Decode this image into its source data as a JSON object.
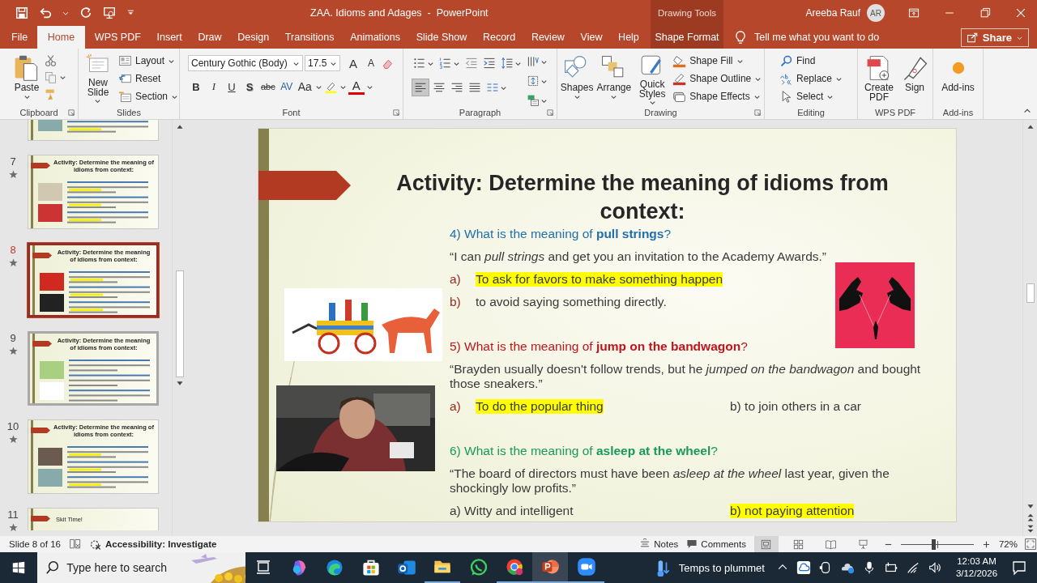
{
  "title_bar": {
    "title": "ZAA. Idioms and Adages  -  PowerPoint",
    "context_label": "Drawing Tools",
    "user_name": "Areeba Rauf",
    "user_initials": "AR"
  },
  "menu_tabs": [
    {
      "label": "File",
      "selected": false,
      "kind": "standard"
    },
    {
      "label": "Home",
      "selected": true,
      "kind": "standard"
    },
    {
      "label": "WPS PDF",
      "selected": false,
      "kind": "standard"
    },
    {
      "label": "Insert",
      "selected": false,
      "kind": "standard"
    },
    {
      "label": "Draw",
      "selected": false,
      "kind": "standard"
    },
    {
      "label": "Design",
      "selected": false,
      "kind": "standard"
    },
    {
      "label": "Transitions",
      "selected": false,
      "kind": "standard"
    },
    {
      "label": "Animations",
      "selected": false,
      "kind": "standard"
    },
    {
      "label": "Slide Show",
      "selected": false,
      "kind": "standard"
    },
    {
      "label": "Record",
      "selected": false,
      "kind": "standard"
    },
    {
      "label": "Review",
      "selected": false,
      "kind": "standard"
    },
    {
      "label": "View",
      "selected": false,
      "kind": "standard"
    },
    {
      "label": "Help",
      "selected": false,
      "kind": "standard"
    },
    {
      "label": "Shape Format",
      "selected": false,
      "kind": "contextual"
    }
  ],
  "tell_me": "Tell me what you want to do",
  "share": "Share",
  "ribbon": {
    "clipboard": {
      "label": "Clipboard",
      "paste": "Paste"
    },
    "slides": {
      "label": "Slides",
      "new_slide": "New Slide",
      "layout": "Layout",
      "reset": "Reset",
      "section": "Section"
    },
    "font": {
      "label": "Font",
      "font_name": "Century Gothic (Body)",
      "font_size": "17.5",
      "size_buttons": [
        "A",
        "A"
      ],
      "format_buttons": [
        "B",
        "I",
        "U",
        "S",
        "abc",
        "AV",
        "Aa"
      ],
      "font_color": "A"
    },
    "paragraph": {
      "label": "Paragraph"
    },
    "drawing": {
      "label": "Drawing",
      "shapes": "Shapes",
      "arrange": "Arrange",
      "quick_styles": "Quick Styles",
      "shape_fill": "Shape Fill",
      "shape_outline": "Shape Outline",
      "shape_effects": "Shape Effects"
    },
    "editing": {
      "label": "Editing",
      "find": "Find",
      "replace": "Replace",
      "select": "Select"
    },
    "wps_pdf": {
      "label": "WPS PDF",
      "create_pdf": "Create PDF",
      "sign": "Sign"
    },
    "add_ins": {
      "label": "Add-ins",
      "add_ins": "Add-ins"
    }
  },
  "thumbnails": [
    {
      "kind": "partial-top",
      "selected": false
    },
    {
      "kind": "full",
      "number": "7",
      "starred": true,
      "selected": false,
      "title": "Activity: Determine the meaning of idioms from context:"
    },
    {
      "kind": "full",
      "number": "8",
      "starred": true,
      "selected": true,
      "title": "Activity: Determine the meaning of idioms from context:"
    },
    {
      "kind": "full",
      "number": "9",
      "starred": true,
      "selected": false,
      "title": "Activity: Determine the meaning of idioms from context:"
    },
    {
      "kind": "full",
      "number": "10",
      "starred": true,
      "selected": false,
      "title": "Activity: Determine the meaning of idioms from context:"
    },
    {
      "kind": "partial-bottom",
      "number": "11",
      "starred": true,
      "selected": false,
      "title": "Skit Time!"
    }
  ],
  "slide": {
    "title": "Activity: Determine the meaning of idioms from context:",
    "questions": [
      {
        "prompt": "4) What is the meaning of **pull strings**?",
        "color": "#1f6fae",
        "quote": "“I can *pull strings* and get you an invitation to the Academy Awards.”",
        "kind": "stacked",
        "options": [
          {
            "label": "a)",
            "text": "To ask for favors to make something happen",
            "highlighted": true
          },
          {
            "label": "b)",
            "text": "to avoid saying something directly.",
            "highlighted": false
          }
        ]
      },
      {
        "prompt": "5) What is the meaning of **jump on the bandwagon**?",
        "color": "#c0151d",
        "quote": "“Brayden usually doesn't follow trends, but he *jumped on the bandwagon* and bought those sneakers.”",
        "kind": "paired",
        "options": [
          {
            "label": "a)",
            "text": "To do the popular thing",
            "highlighted": true
          },
          {
            "text": "b) to join others in a car",
            "highlighted": false
          }
        ]
      },
      {
        "prompt": "6) What is the meaning of **asleep at the wheel**?",
        "color": "#1a9a5a",
        "quote": "“The board of directors must have been *asleep at the wheel* last year, given the shockingly low profits.”",
        "kind": "paired",
        "options": [
          {
            "text": "a) Witty and intelligent",
            "highlighted": false
          },
          {
            "text": "b) not paying attention",
            "highlighted": true
          }
        ]
      }
    ]
  },
  "status_bar": {
    "slide_position": "Slide 8 of 16",
    "accessibility": "Accessibility: Investigate",
    "notes": "Notes",
    "comments": "Comments",
    "views": [
      {
        "kind": "normal",
        "selected": true
      },
      {
        "kind": "sorter",
        "selected": false
      },
      {
        "kind": "reading",
        "selected": false
      },
      {
        "kind": "slideshow",
        "selected": false
      }
    ],
    "zoom": {
      "level": 0.45,
      "reading": "72%"
    }
  },
  "taskbar": {
    "search_placeholder": "Type here to search",
    "weather": "Temps to plummet",
    "time": "12:03 AM",
    "date": "3/12/2026",
    "apps": [
      {
        "kind": "copilot",
        "running": false,
        "selected": false
      },
      {
        "kind": "edge",
        "running": false,
        "selected": false
      },
      {
        "kind": "store",
        "running": false,
        "selected": false
      },
      {
        "kind": "outlook",
        "running": false,
        "selected": false
      },
      {
        "kind": "files",
        "running": true,
        "selected": false
      },
      {
        "kind": "whatsapp",
        "running": false,
        "selected": false
      },
      {
        "kind": "chrome",
        "running": true,
        "selected": false
      },
      {
        "kind": "powerpoint",
        "running": true,
        "selected": true
      },
      {
        "kind": "zoom",
        "running": true,
        "selected": false
      }
    ]
  }
}
